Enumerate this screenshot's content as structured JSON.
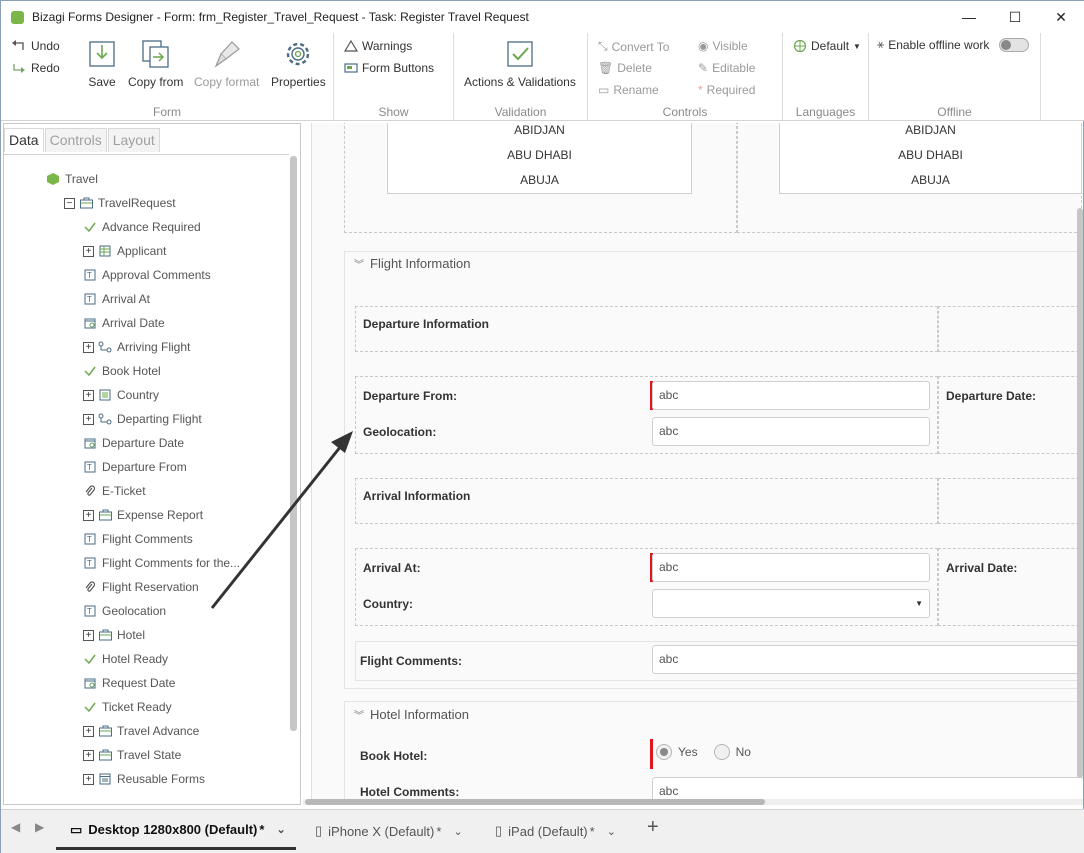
{
  "window": {
    "title": "Bizagi Forms Designer  - Form: frm_Register_Travel_Request - Task:  Register Travel Request",
    "minimize": "—",
    "maximize": "☐",
    "close": "✕"
  },
  "ribbon": {
    "form_group": {
      "name": "Form",
      "undo": "Undo",
      "redo": "Redo",
      "save": "Save",
      "copy_from": "Copy from",
      "copy_format": "Copy format",
      "properties": "Properties"
    },
    "show_group": {
      "name": "Show",
      "warnings": "Warnings",
      "form_buttons": "Form Buttons"
    },
    "validation_group": {
      "name": "Validation",
      "actions_validations": "Actions & Validations"
    },
    "controls_group": {
      "name": "Controls",
      "convert_to": "Convert To",
      "delete": "Delete",
      "rename": "Rename",
      "visible": "Visible",
      "editable": "Editable",
      "required": "Required"
    },
    "languages_group": {
      "name": "Languages",
      "default": "Default"
    },
    "offline_group": {
      "name": "Offline",
      "enable_offline": "Enable offline work"
    }
  },
  "left_panel": {
    "tabs": [
      "Data",
      "Controls",
      "Layout"
    ],
    "root": "Travel",
    "entity": "TravelRequest",
    "items": [
      {
        "label": "Advance Required",
        "icon": "check-icon"
      },
      {
        "label": "Applicant",
        "icon": "table-icon",
        "expandable": true
      },
      {
        "label": "Approval Comments",
        "icon": "text-attribute-icon"
      },
      {
        "label": "Arrival At",
        "icon": "text-attribute-icon"
      },
      {
        "label": "Arrival Date",
        "icon": "calendar-icon"
      },
      {
        "label": "Arriving Flight",
        "icon": "relation-icon",
        "expandable": true
      },
      {
        "label": "Book Hotel",
        "icon": "check-icon"
      },
      {
        "label": "Country",
        "icon": "parameter-icon",
        "expandable": true
      },
      {
        "label": "Departing Flight",
        "icon": "relation-icon",
        "expandable": true
      },
      {
        "label": "Departure Date",
        "icon": "calendar-icon"
      },
      {
        "label": "Departure From",
        "icon": "text-attribute-icon"
      },
      {
        "label": "E-Ticket",
        "icon": "attachment-icon"
      },
      {
        "label": "Expense Report",
        "icon": "entity-icon",
        "expandable": true
      },
      {
        "label": "Flight Comments",
        "icon": "text-attribute-icon"
      },
      {
        "label": "Flight Comments for the...",
        "icon": "text-attribute-icon"
      },
      {
        "label": "Flight Reservation",
        "icon": "attachment-icon"
      },
      {
        "label": "Geolocation",
        "icon": "text-attribute-icon"
      },
      {
        "label": "Hotel",
        "icon": "entity-icon",
        "expandable": true
      },
      {
        "label": "Hotel Ready",
        "icon": "check-icon"
      },
      {
        "label": "Request Date",
        "icon": "calendar-icon"
      },
      {
        "label": "Ticket Ready",
        "icon": "check-icon"
      },
      {
        "label": "Travel Advance",
        "icon": "entity-icon",
        "expandable": true
      },
      {
        "label": "Travel State",
        "icon": "entity-icon",
        "expandable": true
      },
      {
        "label": "Reusable Forms",
        "icon": "forms-icon",
        "expandable": true
      }
    ]
  },
  "form": {
    "list_left": [
      "ABIDJAN",
      "ABU DHABI",
      "ABUJA"
    ],
    "list_right": [
      "ABIDJAN",
      "ABU DHABI",
      "ABUJA"
    ],
    "flight_section": "Flight Information",
    "departure_info": "Departure Information",
    "departure_from_label": "Departure From:",
    "departure_from_value": "abc",
    "departure_date_label": "Departure Date:",
    "geolocation_label": "Geolocation:",
    "geolocation_value": "abc",
    "arrival_info": "Arrival Information",
    "arrival_at_label": "Arrival At:",
    "arrival_at_value": "abc",
    "arrival_date_label": "Arrival Date:",
    "country_label": "Country:",
    "flight_comments_label": "Flight Comments:",
    "flight_comments_value": "abc",
    "hotel_section": "Hotel Information",
    "book_hotel_label": "Book Hotel:",
    "yes": "Yes",
    "no": "No",
    "hotel_comments_label": "Hotel Comments:",
    "hotel_comments_value": "abc"
  },
  "bottom_bar": {
    "devices": [
      "Desktop 1280x800 (Default)",
      "iPhone X (Default)",
      "iPad (Default)"
    ],
    "modified_marker": "*",
    "add": "+"
  },
  "colors": {
    "required_marker": "#e3141b",
    "accent_green": "#7ab648",
    "annotation_arrow": "#333333"
  }
}
